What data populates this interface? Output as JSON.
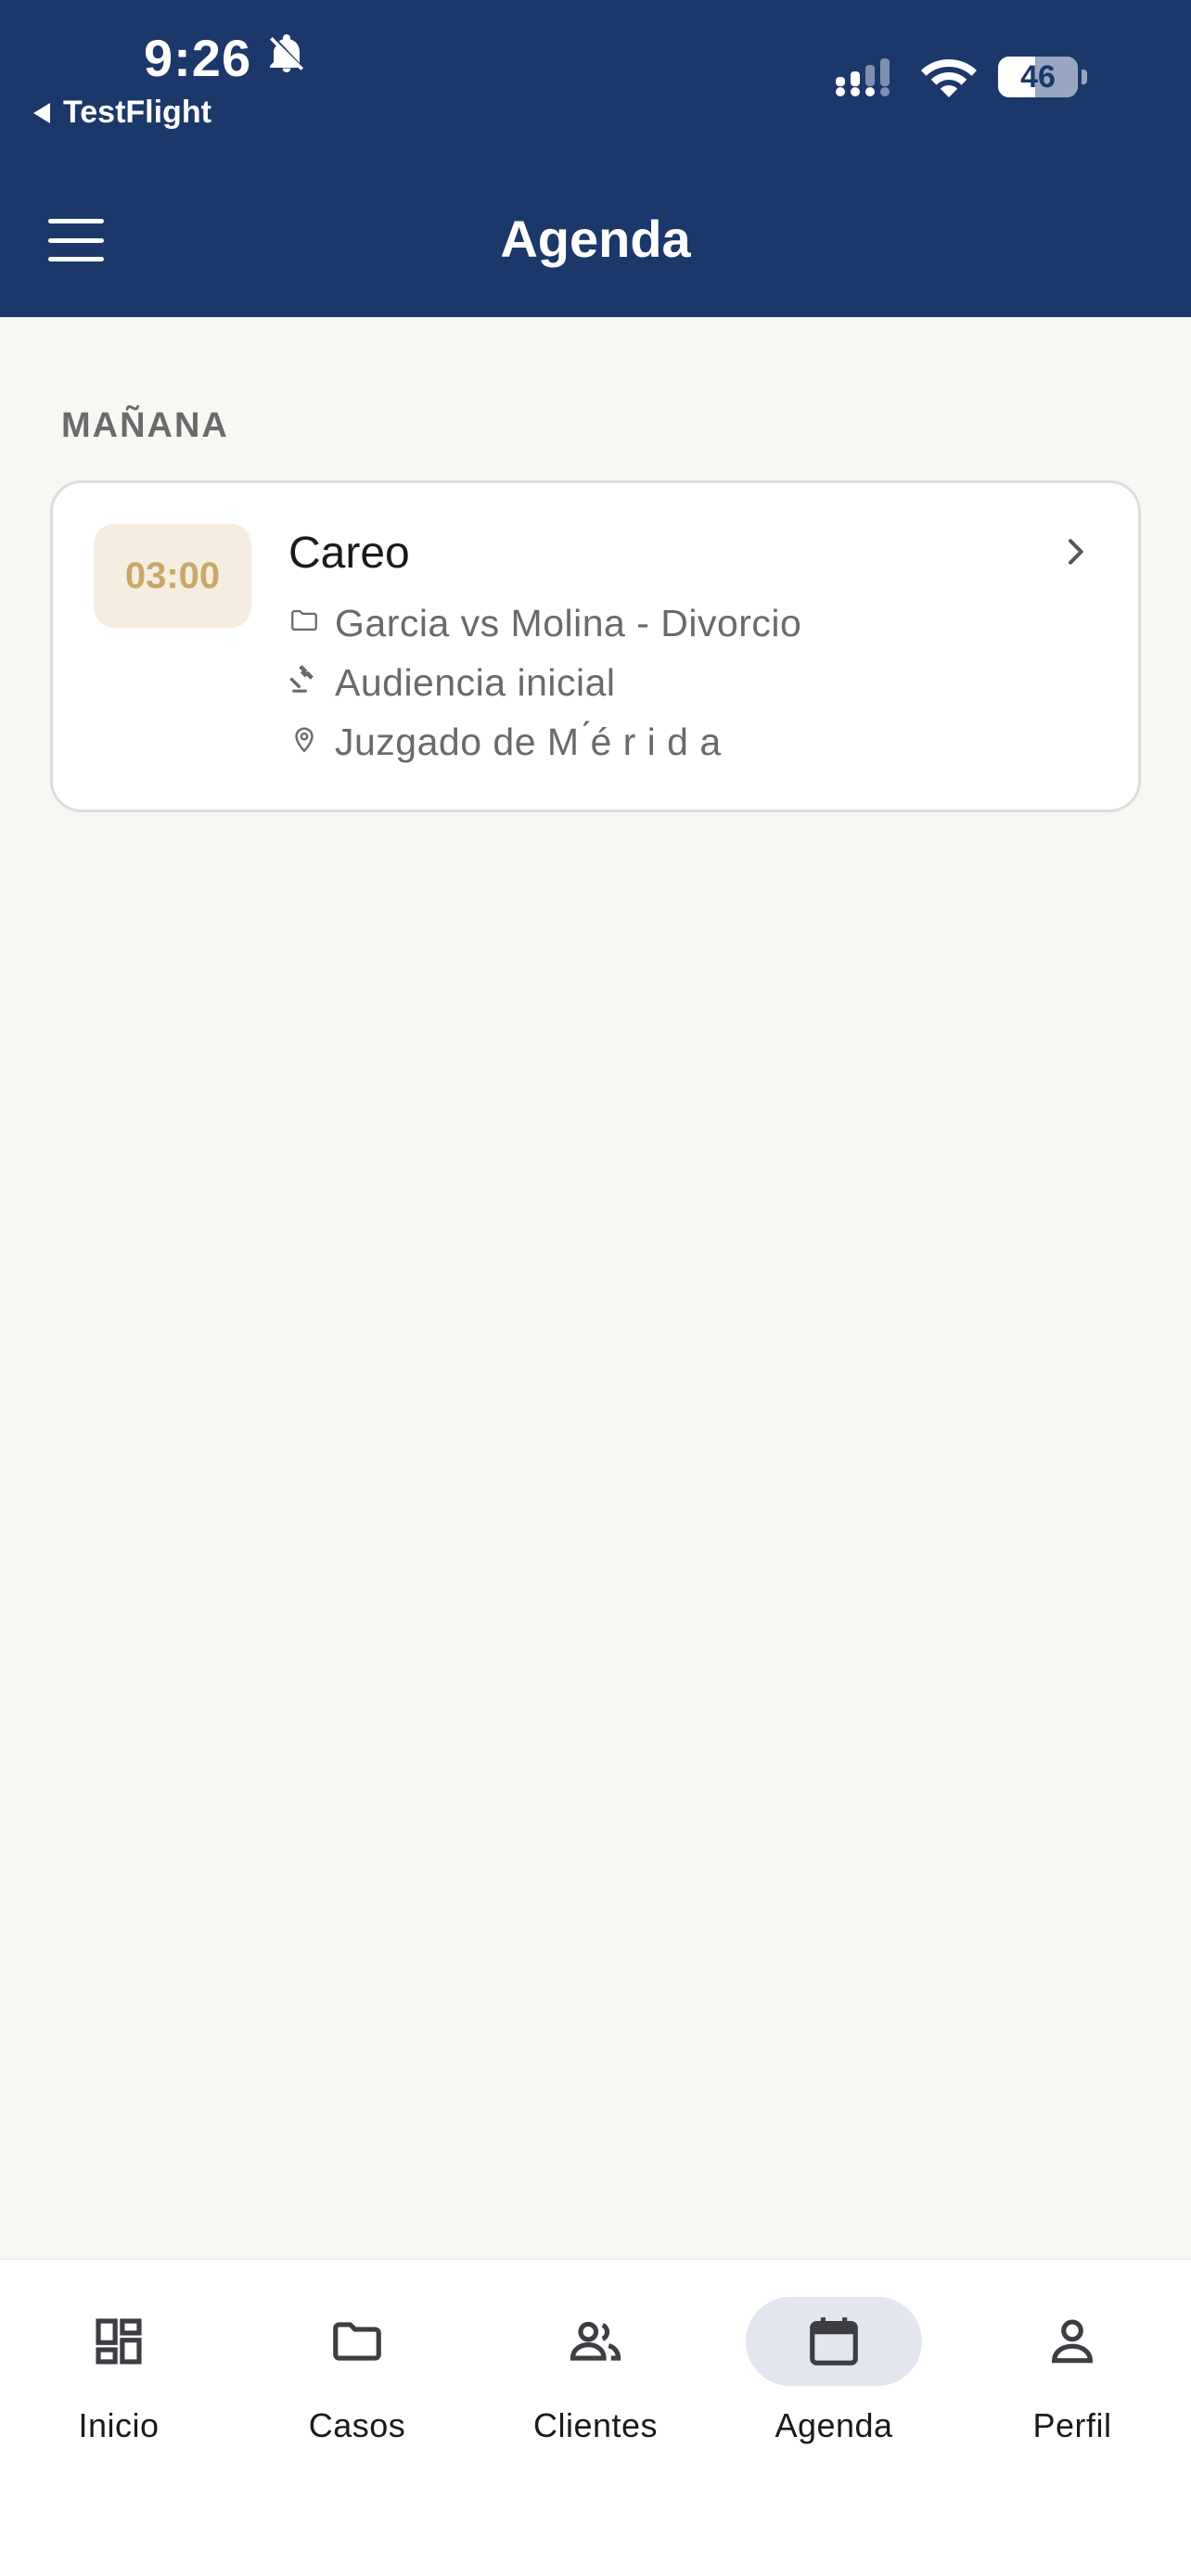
{
  "status_bar": {
    "time": "9:26",
    "back_app": "TestFlight",
    "battery": "46",
    "battery_level": 0.46
  },
  "app_bar": {
    "title": "Agenda"
  },
  "agenda": {
    "section_label": "MAÑANA",
    "events": [
      {
        "time": "03:00",
        "title": "Careo",
        "case": "Garcia vs Molina - Divorcio",
        "type": "Audiencia inicial",
        "place": "Juzgado de M ́é r i d a"
      }
    ]
  },
  "bottom_nav": {
    "items": [
      {
        "label": "Inicio",
        "icon": "dashboard-icon"
      },
      {
        "label": "Casos",
        "icon": "folder-icon"
      },
      {
        "label": "Clientes",
        "icon": "people-icon"
      },
      {
        "label": "Agenda",
        "icon": "calendar-icon",
        "active": true
      },
      {
        "label": "Perfil",
        "icon": "person-icon"
      }
    ]
  },
  "colors": {
    "header_bg": "#1c386b",
    "page_bg": "#f8f7f4",
    "time_badge_bg": "#f5ede0",
    "time_badge_text": "#c8a86a",
    "active_nav_bg": "#e3e6ef"
  }
}
